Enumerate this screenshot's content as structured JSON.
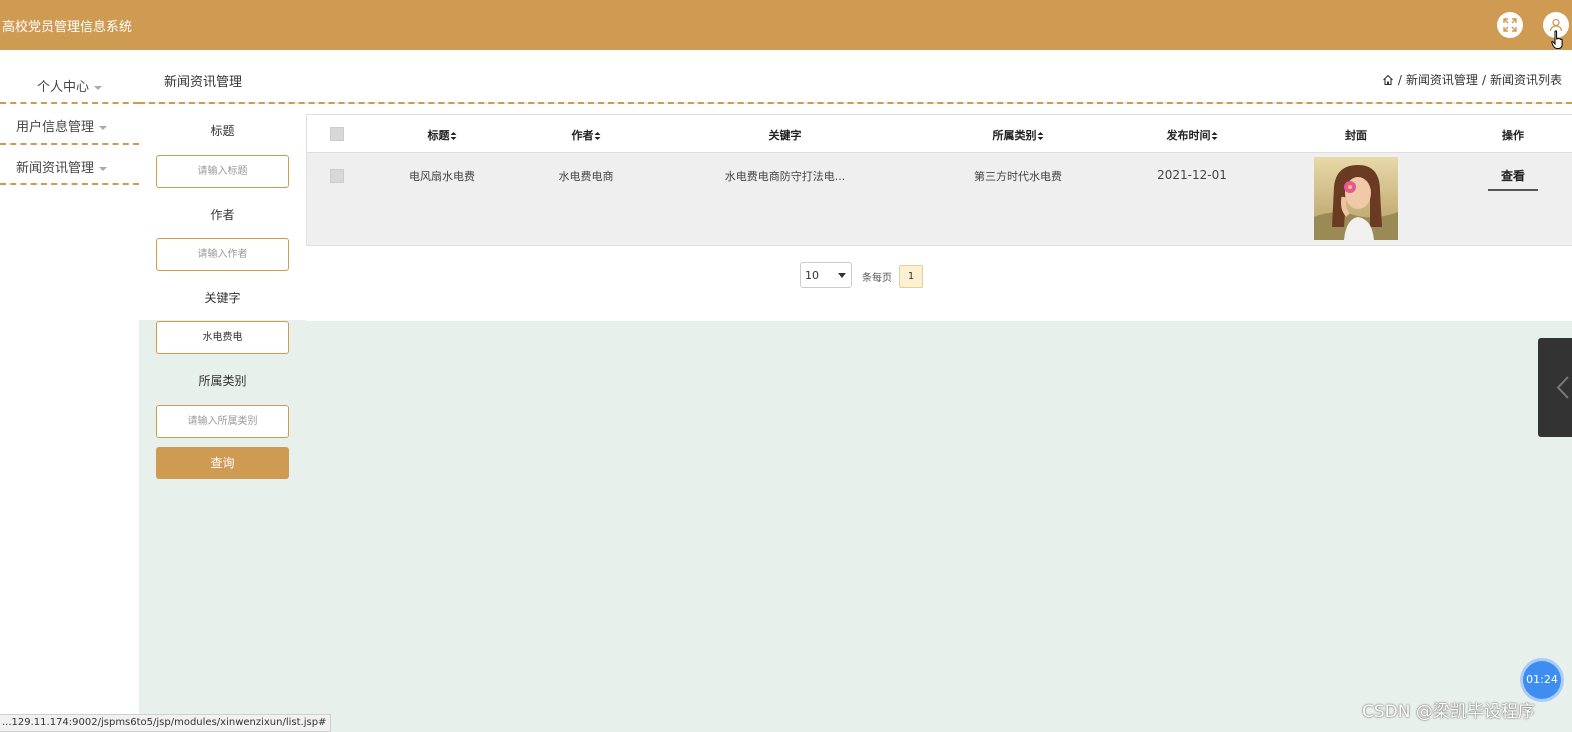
{
  "app": {
    "title": "高校党员管理信息系统"
  },
  "topbar": {
    "icons": [
      "fullscreen-icon",
      "user-icon"
    ]
  },
  "sidebar": {
    "items": [
      {
        "label": "个人中心"
      },
      {
        "label": "用户信息管理"
      },
      {
        "label": "新闻资讯管理"
      }
    ]
  },
  "header": {
    "title": "新闻资讯管理",
    "breadcrumb": {
      "home_icon": "home-icon",
      "sep": "/",
      "item1": "新闻资讯管理",
      "item2": "新闻资讯列表"
    }
  },
  "search": {
    "title_label": "标题",
    "title_placeholder": "请输入标题",
    "author_label": "作者",
    "author_placeholder": "请输入作者",
    "keyword_label": "关键字",
    "keyword_value": "水电费电",
    "category_label": "所属类别",
    "category_placeholder": "请输入所属类别",
    "query_button": "查询"
  },
  "table": {
    "columns": [
      "标题",
      "作者",
      "关键字",
      "所属类别",
      "发布时间",
      "封面",
      "操作"
    ],
    "rows": [
      {
        "title": "电风扇水电费",
        "author": "水电费电商",
        "keyword": "水电费电商防守打法电...",
        "category": "第三方时代水电费",
        "date": "2021-12-01",
        "cover": "portrait-photo",
        "action": "查看"
      }
    ]
  },
  "pagination": {
    "page_size": "10",
    "per_page_label": "条每页",
    "current_page": "1"
  },
  "overlay": {
    "timer": "01:24",
    "watermark": "CSDN @梁凯毕设程序",
    "status_url": "...129.11.174:9002/jspms6to5/jsp/modules/xinwenzixun/list.jsp#"
  },
  "colors": {
    "accent": "#cf9a52",
    "content_bg": "#e8f0eb",
    "page_active": "#fbf0cf"
  }
}
